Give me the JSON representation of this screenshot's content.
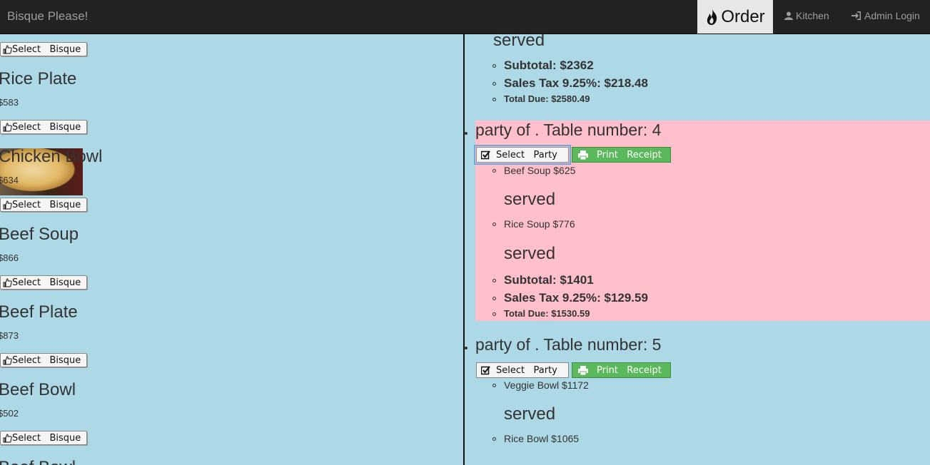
{
  "navbar": {
    "brand": "Bisque Please!",
    "order": "Order",
    "kitchen": "Kitchen",
    "admin_login": "Admin Login"
  },
  "menu": {
    "select_label": "Select   Bisque",
    "items": [
      {
        "name": "Rice Plate",
        "price": "$583"
      },
      {
        "name": "Chicken Bowl",
        "price": "$634"
      },
      {
        "name": "Beef Soup",
        "price": "$866"
      },
      {
        "name": "Beef Plate",
        "price": "$873"
      },
      {
        "name": "Beef Bowl",
        "price": "$502"
      },
      {
        "name": "Beef Bowl",
        "price": ""
      }
    ]
  },
  "orders": {
    "served_label": "served",
    "select_party_label": "Select   Party",
    "print_receipt_label": "Print   Receipt",
    "previous": {
      "subtotal": "Subtotal: $2362",
      "tax": "Sales Tax 9.25%: $218.48",
      "total": "Total Due: $2580.49"
    },
    "parties": [
      {
        "title": "party of . Table number: 4",
        "lines": [
          "Beef Soup $625",
          "Rice Soup $776"
        ],
        "subtotal": "Subtotal: $1401",
        "tax": "Sales Tax 9.25%: $129.59",
        "total": "Total Due: $1530.59"
      },
      {
        "title": "party of . Table number: 5",
        "lines": [
          "Veggie Bowl $1172",
          "Rice Bowl $1065"
        ]
      }
    ]
  }
}
